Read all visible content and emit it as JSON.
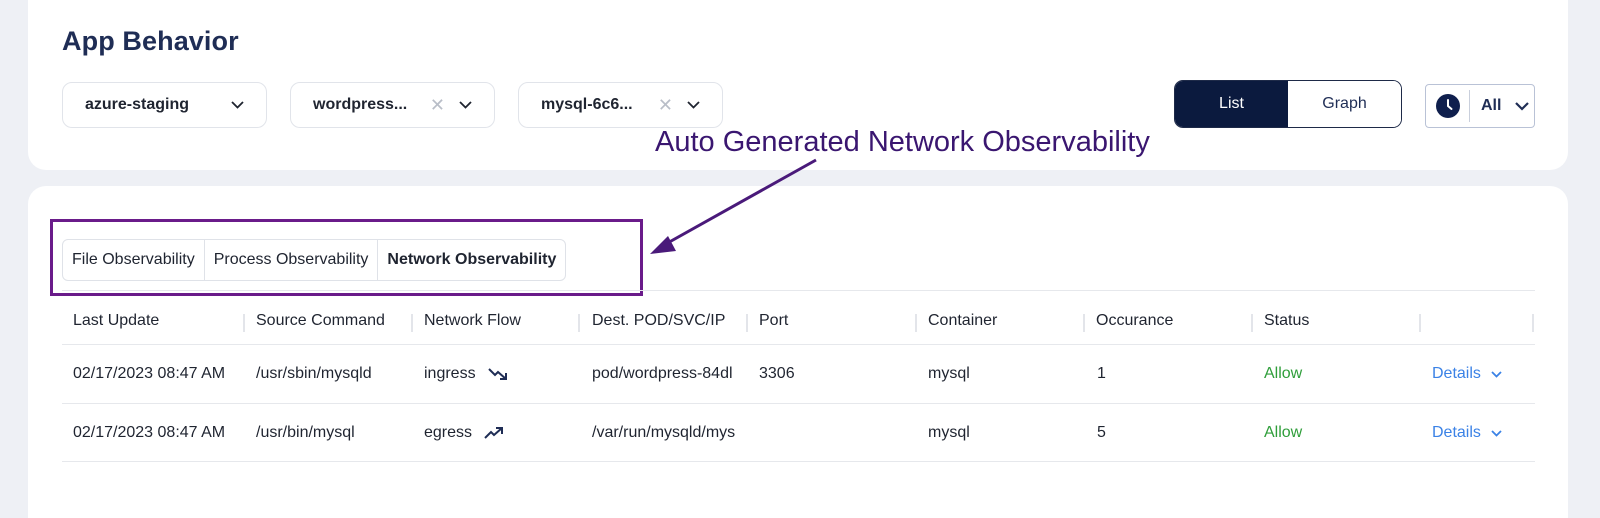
{
  "page": {
    "title": "App Behavior"
  },
  "filters": {
    "cluster": {
      "value": "azure-staging"
    },
    "namespace": {
      "value": "wordpress..."
    },
    "pod": {
      "value": "mysql-6c6..."
    }
  },
  "view_toggle": {
    "list": "List",
    "graph": "Graph",
    "selected": "List"
  },
  "time_filter": {
    "value": "All"
  },
  "annotation": {
    "text": "Auto Generated Network Observability"
  },
  "tabs": [
    {
      "label": "File Observability",
      "active": false
    },
    {
      "label": "Process Observability",
      "active": false
    },
    {
      "label": "Network Observability",
      "active": true
    }
  ],
  "table": {
    "headers": [
      "Last Update",
      "Source Command",
      "Network Flow",
      "Dest. POD/SVC/IP",
      "Port",
      "Container",
      "Occurance",
      "Status",
      ""
    ],
    "rows": [
      {
        "last_update": "02/17/2023 08:47 AM",
        "source_command": "/usr/sbin/mysqld",
        "network_flow": "ingress",
        "flow_icon": "trending-down-icon",
        "dest": "pod/wordpress-84dl",
        "port": "3306",
        "container": "mysql",
        "occurance": "1",
        "status": "Allow",
        "details": "Details"
      },
      {
        "last_update": "02/17/2023 08:47 AM",
        "source_command": "/usr/bin/mysql",
        "network_flow": "egress",
        "flow_icon": "trending-up-icon",
        "dest": "/var/run/mysqld/mys",
        "port": "",
        "container": "mysql",
        "occurance": "5",
        "status": "Allow",
        "details": "Details"
      }
    ]
  },
  "colors": {
    "primary_dark": "#0b1a3e",
    "annotation": "#6a1b8a",
    "allow": "#2f9e3a",
    "link": "#3b82e6"
  }
}
